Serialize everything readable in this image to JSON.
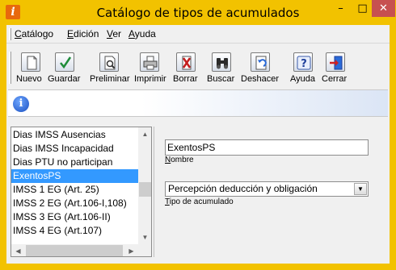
{
  "window": {
    "title": "Catálogo de tipos de acumulados",
    "minimize": "–",
    "maximize": "□",
    "close": "✕"
  },
  "menu": [
    {
      "label": "Catálogo",
      "accel": "C",
      "rest": "atálogo"
    },
    {
      "label": "Edición",
      "accel": "E",
      "rest": "dición"
    },
    {
      "label": "Ver",
      "accel": "V",
      "rest": "er"
    },
    {
      "label": "Ayuda",
      "accel": "A",
      "rest": "yuda"
    }
  ],
  "toolbar": {
    "nuevo": "Nuevo",
    "guardar": "Guardar",
    "preliminar": "Preliminar",
    "imprimir": "Imprimir",
    "borrar": "Borrar",
    "buscar": "Buscar",
    "deshacer": "Deshacer",
    "ayuda": "Ayuda",
    "cerrar": "Cerrar"
  },
  "list": {
    "items": [
      "Dias IMSS Ausencias",
      "Dias IMSS Incapacidad",
      "Dias PTU no participan",
      "ExentosPS",
      "IMSS 1 EG (Art. 25)",
      "IMSS 2 EG (Art.106-I,108)",
      "IMSS 3 EG (Art.106-II)",
      "IMSS 4 EG (Art.107)"
    ],
    "selected_index": 3
  },
  "form": {
    "name_value": "ExentosPS",
    "name_label": "Nombre",
    "type_value": "Percepción deducción y obligación",
    "type_label": "Tipo de acumulado"
  },
  "colors": {
    "frame": "#f2c200",
    "selection": "#3399ff",
    "close_button": "#c75050"
  },
  "icons": [
    "app-icon",
    "new-document-icon",
    "save-check-icon",
    "preview-icon",
    "printer-icon",
    "delete-x-icon",
    "binoculars-icon",
    "undo-icon",
    "help-question-icon",
    "exit-door-icon",
    "info-icon"
  ]
}
